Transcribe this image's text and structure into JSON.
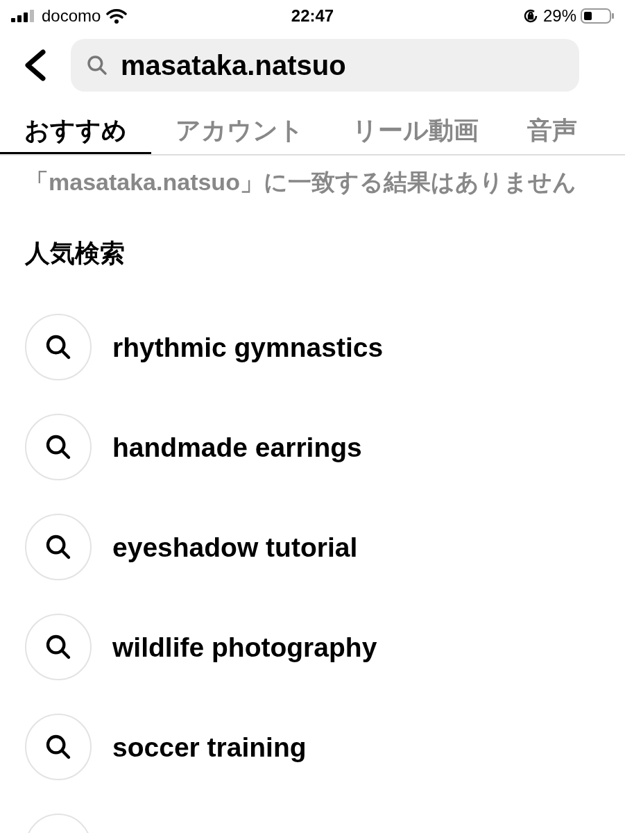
{
  "status_bar": {
    "carrier": "docomo",
    "time": "22:47",
    "battery": "29%"
  },
  "search": {
    "value": "masataka.natsuo"
  },
  "tabs": [
    {
      "label": "おすすめ",
      "selected": true
    },
    {
      "label": "アカウント",
      "selected": false
    },
    {
      "label": "リール動画",
      "selected": false
    },
    {
      "label": "音声",
      "selected": false
    }
  ],
  "message": "「masataka.natsuo」に一致する結果はありません",
  "popular": {
    "heading": "人気検索",
    "items": [
      "rhythmic gymnastics",
      "handmade earrings",
      "eyeshadow tutorial",
      "wildlife photography",
      "soccer training"
    ]
  }
}
